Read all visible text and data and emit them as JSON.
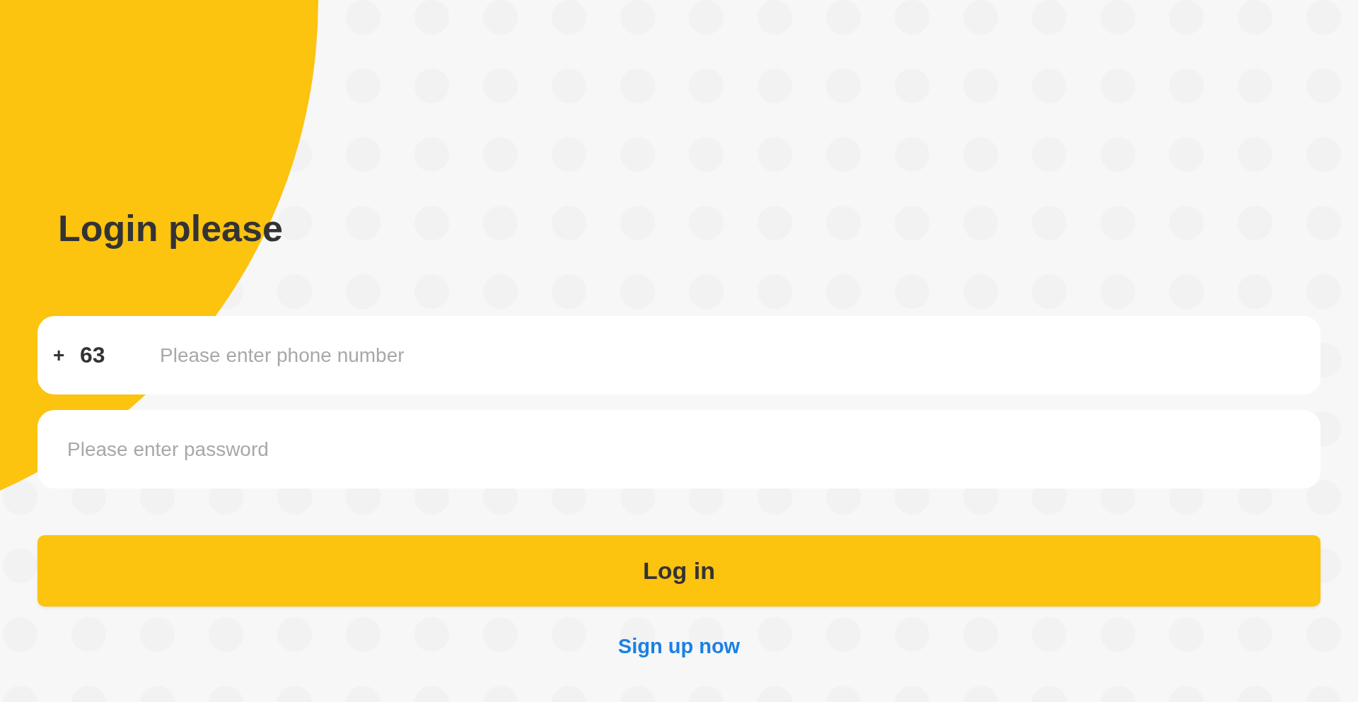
{
  "title": "Login please",
  "phone_field": {
    "prefix": "+",
    "country_code": "63",
    "placeholder": "Please enter phone number"
  },
  "password_field": {
    "placeholder": "Please enter password"
  },
  "login_button": {
    "label": "Log in"
  },
  "signup_link": {
    "label": "Sign up now"
  }
}
